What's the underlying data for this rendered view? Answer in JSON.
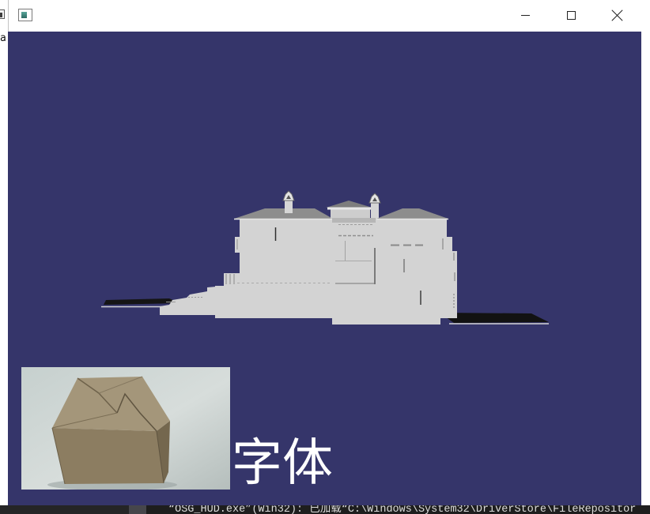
{
  "background_window": {
    "visible_text": "a",
    "icon": "window-icon"
  },
  "window": {
    "app_icon": "app-window-icon",
    "controls": {
      "minimize": "minimize-icon",
      "maximize": "maximize-icon",
      "close": "close-icon"
    }
  },
  "viewport": {
    "background_color": "#35356a",
    "model_color": "#d3d3d3",
    "hud": {
      "text": "字体",
      "text_color": "#ffffff"
    }
  },
  "output_panel": {
    "line": "“OSG_HUD.exe”(Win32): 已加载“C:\\Windows\\System32\\DriverStore\\FileRepositor",
    "background_color": "#1e1e1e",
    "text_color": "#dcdcdc"
  }
}
